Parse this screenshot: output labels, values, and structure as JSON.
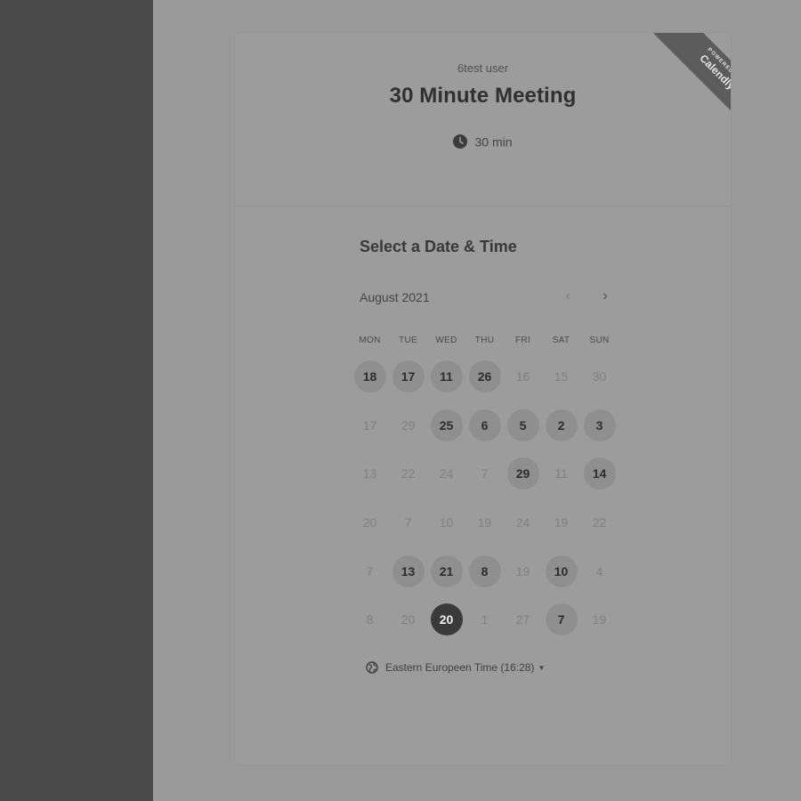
{
  "event": {
    "owner": "6test user",
    "title": "30 Minute Meeting",
    "duration": "30 min"
  },
  "branding": {
    "line1": "POWERED BY",
    "line2": "Calendly"
  },
  "scheduler": {
    "heading": "Select a Date & Time",
    "month": "August 2021",
    "weekdays": [
      "MON",
      "TUE",
      "WED",
      "THU",
      "FRI",
      "SAT",
      "SUN"
    ],
    "weeks": [
      [
        {
          "d": "18",
          "s": "a"
        },
        {
          "d": "17",
          "s": "a"
        },
        {
          "d": "11",
          "s": "a"
        },
        {
          "d": "26",
          "s": "a"
        },
        {
          "d": "16",
          "s": "u"
        },
        {
          "d": "15",
          "s": "u"
        },
        {
          "d": "30",
          "s": "u"
        }
      ],
      [
        {
          "d": "17",
          "s": "u"
        },
        {
          "d": "29",
          "s": "u"
        },
        {
          "d": "25",
          "s": "a"
        },
        {
          "d": "6",
          "s": "a"
        },
        {
          "d": "5",
          "s": "a"
        },
        {
          "d": "2",
          "s": "a"
        },
        {
          "d": "3",
          "s": "a"
        }
      ],
      [
        {
          "d": "13",
          "s": "u"
        },
        {
          "d": "22",
          "s": "u"
        },
        {
          "d": "24",
          "s": "u"
        },
        {
          "d": "7",
          "s": "u"
        },
        {
          "d": "29",
          "s": "a"
        },
        {
          "d": "11",
          "s": "u"
        },
        {
          "d": "14",
          "s": "a"
        }
      ],
      [
        {
          "d": "20",
          "s": "u"
        },
        {
          "d": "7",
          "s": "u"
        },
        {
          "d": "10",
          "s": "u"
        },
        {
          "d": "19",
          "s": "u"
        },
        {
          "d": "24",
          "s": "u"
        },
        {
          "d": "19",
          "s": "u"
        },
        {
          "d": "22",
          "s": "u"
        }
      ],
      [
        {
          "d": "7",
          "s": "u"
        },
        {
          "d": "13",
          "s": "a"
        },
        {
          "d": "21",
          "s": "a"
        },
        {
          "d": "8",
          "s": "a"
        },
        {
          "d": "19",
          "s": "u"
        },
        {
          "d": "10",
          "s": "a"
        },
        {
          "d": "4",
          "s": "u"
        }
      ],
      [
        {
          "d": "8",
          "s": "u"
        },
        {
          "d": "20",
          "s": "u"
        },
        {
          "d": "20",
          "s": "sel"
        },
        {
          "d": "1",
          "s": "u"
        },
        {
          "d": "27",
          "s": "u"
        },
        {
          "d": "7",
          "s": "a"
        },
        {
          "d": "19",
          "s": "u"
        }
      ]
    ],
    "timezone": "Eastern Europeen Time (16:28)"
  },
  "icons": {
    "clock": "clock-icon",
    "globe": "globe-icon",
    "prev": "chevron-left-icon",
    "next": "chevron-right-icon",
    "caret": "caret-down-icon"
  },
  "colors": {
    "overlay_bg": "#9a9a9a",
    "side_panel": "#4a4a4a",
    "available_day": "#8f8f8f",
    "selected_day": "#3a3a3a"
  }
}
